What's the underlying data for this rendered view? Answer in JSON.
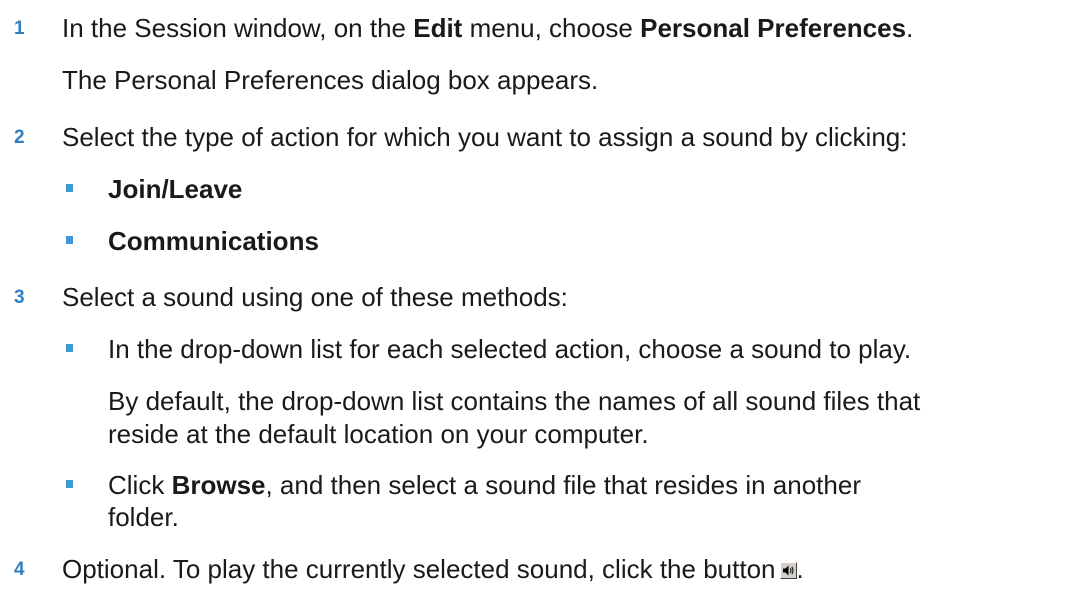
{
  "steps": [
    {
      "number": "1",
      "pre": "In the Session window, on the ",
      "bold1": "Edit",
      "mid": " menu, choose ",
      "bold2": "Personal Preferences",
      "post": ".",
      "note": "The Personal Preferences dialog box appears."
    },
    {
      "number": "2",
      "text": "Select the type of action for which you want to assign a sound by clicking:",
      "bullets": [
        "Join/Leave",
        "Communications"
      ]
    },
    {
      "number": "3",
      "text": "Select a sound using one of these methods:",
      "bullet1": "In the drop-down list for each selected action, choose a sound to play.",
      "bullet1_note_line1": "By default, the drop-down list contains the names of all sound files that",
      "bullet1_note_line2": "reside at the default location on your computer.",
      "bullet2_pre": "Click ",
      "bullet2_bold": "Browse",
      "bullet2_post_line1": ", and then select a sound file that resides in another",
      "bullet2_line2": "folder."
    },
    {
      "number": "4",
      "text": "Optional. To play the currently selected sound, click the button",
      "end": ".",
      "button_icon": "speaker-icon"
    }
  ],
  "colors": {
    "number": "#2F7FC1",
    "bullet": "#3C9AD8",
    "text": "#1a1a1a"
  }
}
